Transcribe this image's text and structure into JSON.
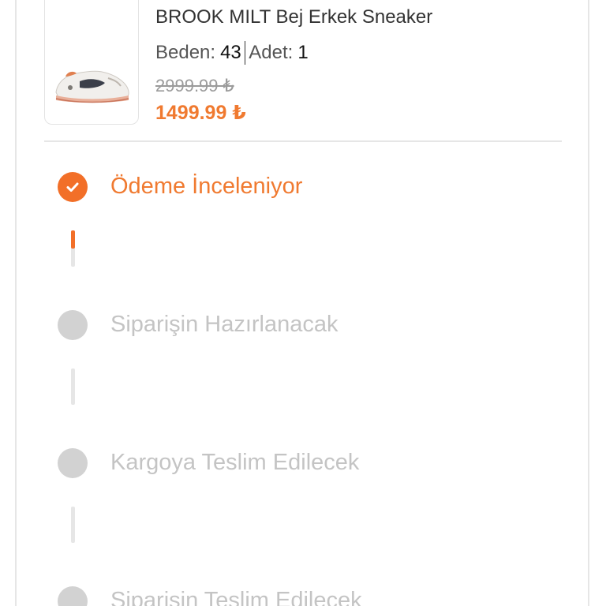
{
  "product": {
    "title": "BROOK MILT Bej Erkek Sneaker",
    "size_label": "Beden:",
    "size_value": "43",
    "quantity_label": "Adet:",
    "quantity_value": "1",
    "old_price": "2999.99 ₺",
    "new_price": "1499.99 ₺"
  },
  "status": {
    "steps": [
      {
        "label": "Ödeme İnceleniyor",
        "completed": true
      },
      {
        "label": "Siparişin Hazırlanacak",
        "completed": false
      },
      {
        "label": "Kargoya Teslim Edilecek",
        "completed": false
      },
      {
        "label": "Siparişin Teslim Edilecek",
        "completed": false
      }
    ],
    "connectors": [
      {
        "progress": 0.5
      },
      {
        "progress": 0
      },
      {
        "progress": 0
      }
    ]
  },
  "colors": {
    "accent": "#f26f28",
    "inactive": "#d2d2d2"
  },
  "icons": {
    "step_done": "checkmark-icon",
    "product": "sneaker-image"
  }
}
